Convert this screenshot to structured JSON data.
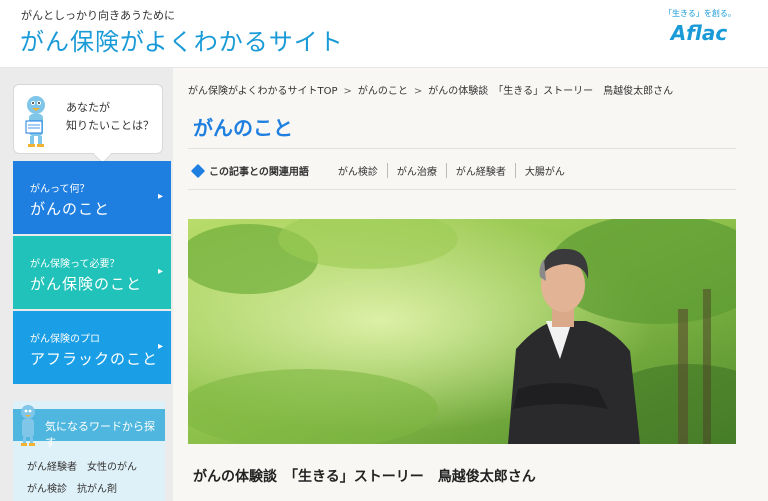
{
  "header": {
    "tagline": "がんとしっかり向きあうために",
    "site_title": "がん保険がよくわかるサイト",
    "logo_slogan": "「生きる」を創る。",
    "logo_text": "Aflac"
  },
  "sidebar": {
    "bubble_line1": "あなたが",
    "bubble_line2": "知りたいことは？",
    "nav": [
      {
        "small": "がんって何？",
        "big": "がんのこと"
      },
      {
        "small": "がん保険って必要？",
        "big": "がん保険のこと"
      },
      {
        "small": "がん保険のプロ",
        "big": "アフラックのこと"
      }
    ],
    "word_search_title": "気になるワードから探す",
    "word_tags": [
      "がん経験者",
      "女性のがん",
      "がん検診",
      "抗がん剤"
    ]
  },
  "main": {
    "breadcrumb": [
      "がん保険がよくわかるサイトTOP",
      "がんのこと",
      "がんの体験談　「生きる」ストーリー　鳥越俊太郎さん"
    ],
    "page_title": "がんのこと",
    "related_label": "この記事との関連用語",
    "related_terms": [
      "がん検診",
      "がん治療",
      "がん経験者",
      "大腸がん"
    ],
    "article_title": "がんの体験談　「生きる」ストーリー　鳥越俊太郎さん"
  },
  "colors": {
    "brand_blue": "#1a9bd7",
    "nav_blue": "#1e7fe0",
    "nav_teal": "#20c2b9",
    "nav_sky": "#1a9fe6"
  }
}
